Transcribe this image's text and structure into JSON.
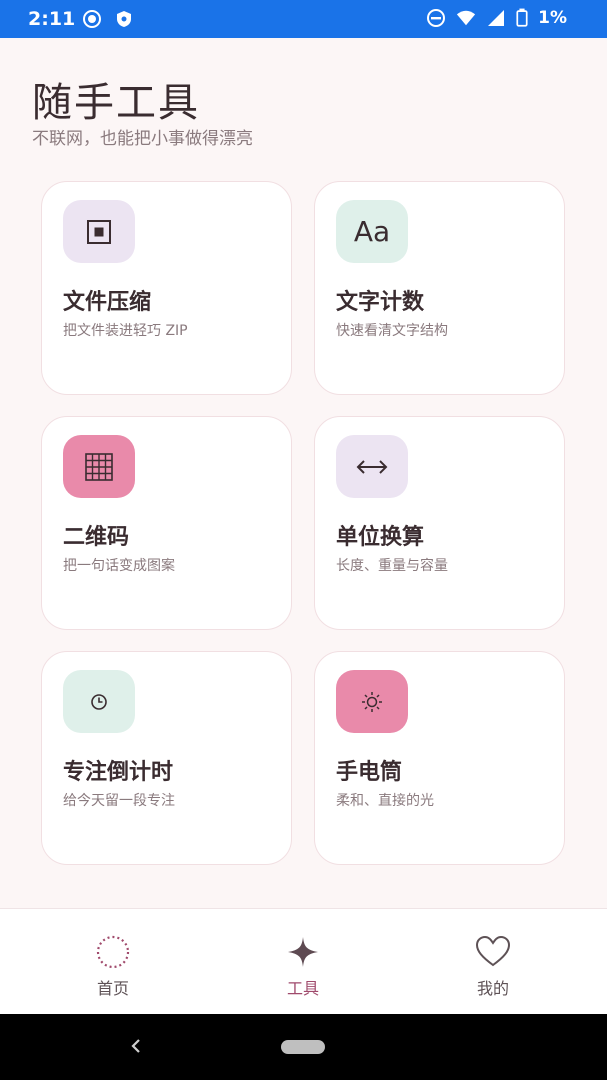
{
  "status_bar": {
    "time": "2:11",
    "battery": "1%",
    "left_icons": [
      "record-icon",
      "shield-icon"
    ],
    "right_icons": [
      "dnd-icon",
      "wifi-icon",
      "signal-icon",
      "battery-icon"
    ],
    "color": "#1a73e8"
  },
  "header": {
    "title": "随手工具",
    "subtitle": "不联网，也能把小事做得漂亮"
  },
  "tools": [
    {
      "name": "文件压缩",
      "desc": "把文件装进轻巧 ZIP",
      "icon": "compress-icon",
      "tile_color": "#ece4f2"
    },
    {
      "name": "文字计数",
      "desc": "快速看清文字结构",
      "icon_text": "Aa",
      "icon": "text-icon",
      "tile_color": "#dff0ea"
    },
    {
      "name": "二维码",
      "desc": "把一句话变成图案",
      "icon": "qr-grid-icon",
      "tile_color": "#e98aaa"
    },
    {
      "name": "单位换算",
      "desc": "长度、重量与容量",
      "icon": "convert-arrows-icon",
      "tile_color": "#ece4f2"
    },
    {
      "name": "专注倒计时",
      "desc": "给今天留一段专注",
      "icon": "clock-icon",
      "tile_color": "#dff0ea"
    },
    {
      "name": "手电筒",
      "desc": "柔和、直接的光",
      "icon": "sun-icon",
      "tile_color": "#e98aaa"
    }
  ],
  "bottom_nav": {
    "items": [
      {
        "label": "首页",
        "icon": "home-dotted-circle-icon"
      },
      {
        "label": "工具",
        "icon": "sparkle-icon",
        "active": true
      },
      {
        "label": "我的",
        "icon": "heart-icon"
      }
    ],
    "active_color": "#a04a6c"
  }
}
